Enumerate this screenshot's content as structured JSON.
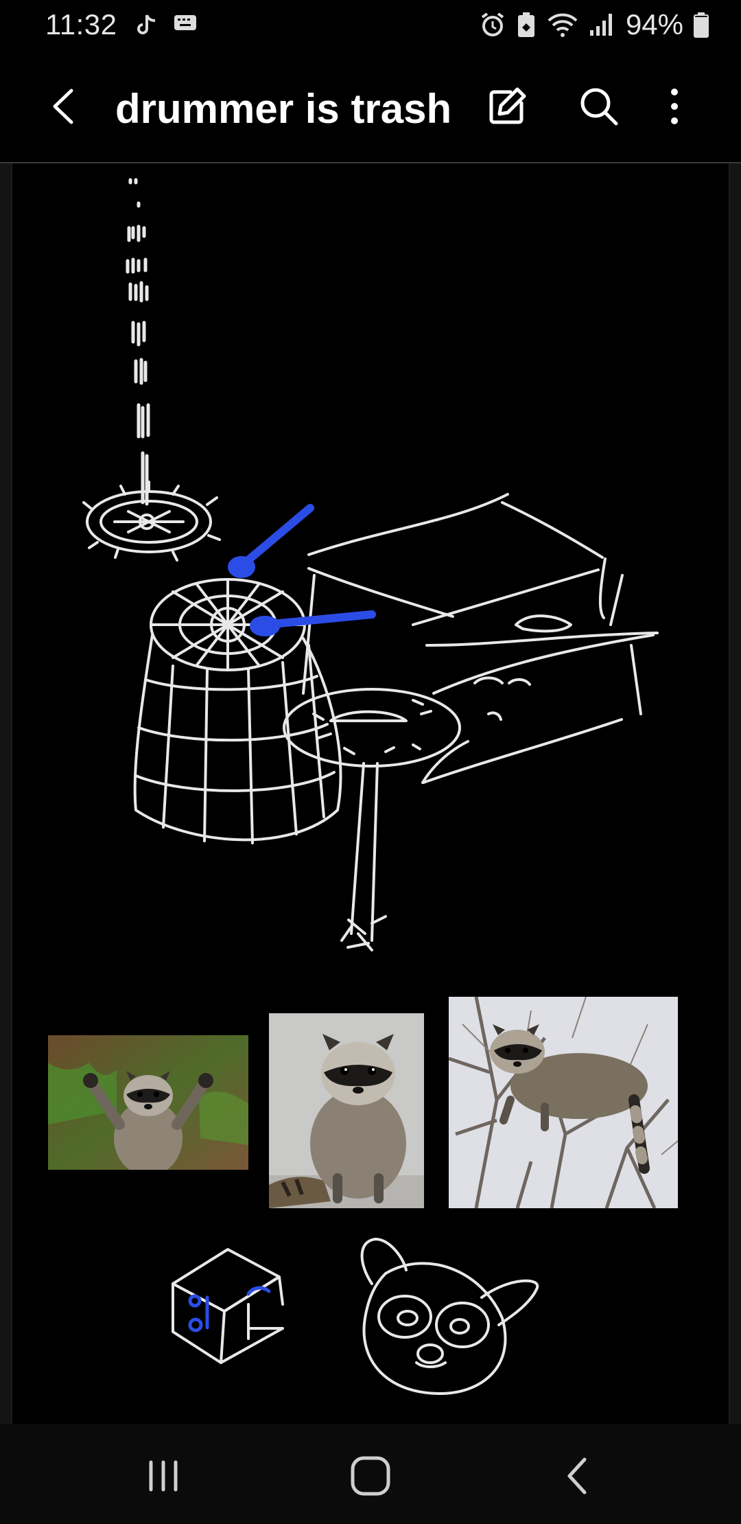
{
  "status_bar": {
    "time": "11:32",
    "left_icons": [
      "tiktok-icon",
      "keyboard-icon"
    ],
    "right_icons": [
      "alarm-icon",
      "battery-saver-icon",
      "wifi-icon",
      "signal-icon"
    ],
    "battery_text": "94%",
    "battery_level": 0.94
  },
  "app_bar": {
    "title": "drummer is trash",
    "back_icon": "back-arrow-icon",
    "actions": [
      "edit-icon",
      "search-icon",
      "more-vert-icon"
    ]
  },
  "canvas": {
    "ink_colors": {
      "stroke": "#e8e8e8",
      "highlight": "#2b4de6"
    },
    "photos": [
      "raccoon-arms-up-photo",
      "raccoon-sitting-photo",
      "raccoon-in-tree-photo"
    ]
  },
  "nav_bar": {
    "buttons": [
      "recents-icon",
      "home-icon",
      "back-icon"
    ]
  }
}
